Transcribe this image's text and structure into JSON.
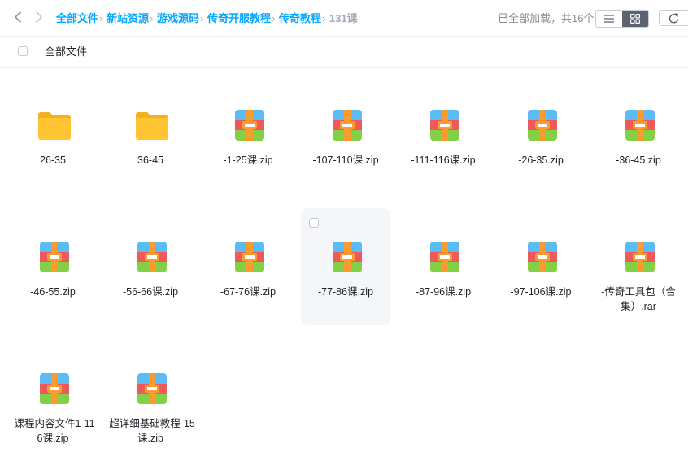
{
  "nav": {
    "breadcrumb": [
      "全部文件",
      "新站资源",
      "游戏源码",
      "传奇开服教程",
      "传奇教程"
    ],
    "current": "131课",
    "separator": "›"
  },
  "status": "已全部加载，共16个",
  "select_all_label": "全部文件",
  "colors": {
    "accent": "#06a7ff",
    "folder": "#ffc533",
    "zip_top": "#5bbcf5",
    "zip_mid": "#f0595a",
    "zip_bottom": "#83cf45",
    "zip_belt": "#f99b2e"
  },
  "files": [
    {
      "name": "26-35",
      "icon": "folder-icon"
    },
    {
      "name": "36-45",
      "icon": "folder-icon"
    },
    {
      "name": "-1-25课.zip",
      "icon": "archive-icon"
    },
    {
      "name": "-107-110课.zip",
      "icon": "archive-icon"
    },
    {
      "name": "-111-116课.zip",
      "icon": "archive-icon"
    },
    {
      "name": "-26-35.zip",
      "icon": "archive-icon"
    },
    {
      "name": "-36-45.zip",
      "icon": "archive-icon"
    },
    {
      "name": "-46-55.zip",
      "icon": "archive-icon"
    },
    {
      "name": "-56-66课.zip",
      "icon": "archive-icon"
    },
    {
      "name": "-67-76课.zip",
      "icon": "archive-icon"
    },
    {
      "name": "-77-86课.zip",
      "icon": "archive-icon",
      "hover": true
    },
    {
      "name": "-87-96课.zip",
      "icon": "archive-icon"
    },
    {
      "name": "-97-106课.zip",
      "icon": "archive-icon"
    },
    {
      "name": "-传奇工具包（合集）.rar",
      "icon": "archive-icon"
    },
    {
      "name": "-课程内容文件1-116课.zip",
      "icon": "archive-icon"
    },
    {
      "name": "-超详细基础教程-15课.zip",
      "icon": "archive-icon"
    }
  ]
}
